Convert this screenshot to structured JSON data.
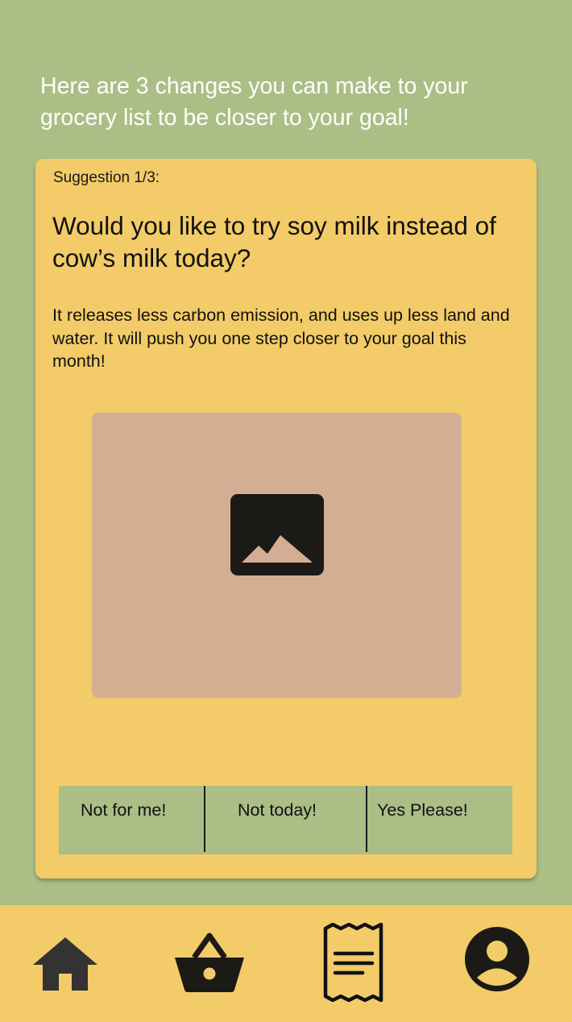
{
  "header": {
    "text": "Here are 3 changes you can make to your grocery list to be closer to your goal!"
  },
  "suggestion": {
    "counter": "Suggestion 1/3:",
    "question": "Would you like to try soy milk instead of cow’s milk today?",
    "description": "It releases less carbon emission, and uses up less land and water. It will push you one step closer to your goal this month!",
    "image_icon": "image-placeholder-icon"
  },
  "choices": {
    "reject": "Not for me!",
    "later": "Not today!",
    "accept": "Yes Please!"
  },
  "nav": {
    "items": [
      {
        "icon": "home-icon"
      },
      {
        "icon": "basket-icon"
      },
      {
        "icon": "receipt-icon"
      },
      {
        "icon": "profile-icon"
      }
    ]
  },
  "colors": {
    "background": "#abbe86",
    "card": "#f3cb68",
    "image_placeholder": "#d4ae92",
    "icon": "#1c1a17"
  }
}
